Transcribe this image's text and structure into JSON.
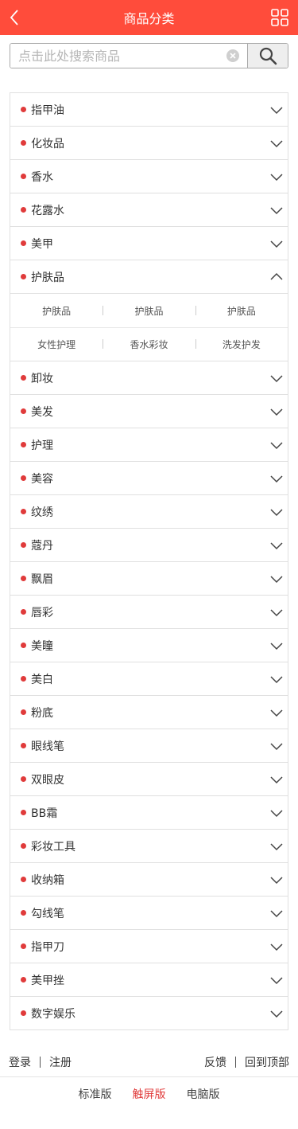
{
  "header": {
    "title": "商品分类",
    "back_icon": "chevron-left-icon",
    "menu_icon": "grid-icon",
    "accent": "#ff4c3b"
  },
  "search": {
    "placeholder": "点击此处搜索商品",
    "value": "",
    "clear_icon": "clear-icon",
    "button_icon": "search-icon"
  },
  "categories": [
    {
      "label": "指甲油",
      "expanded": false
    },
    {
      "label": "化妆品",
      "expanded": false
    },
    {
      "label": "香水",
      "expanded": false
    },
    {
      "label": "花露水",
      "expanded": false
    },
    {
      "label": "美甲",
      "expanded": false
    },
    {
      "label": "护肤品",
      "expanded": true,
      "subs": [
        "护肤品",
        "护肤品",
        "护肤品",
        "女性护理",
        "香水彩妆",
        "洗发护发"
      ]
    },
    {
      "label": "卸妆",
      "expanded": false
    },
    {
      "label": "美发",
      "expanded": false
    },
    {
      "label": "护理",
      "expanded": false
    },
    {
      "label": "美容",
      "expanded": false
    },
    {
      "label": "纹绣",
      "expanded": false
    },
    {
      "label": "蔻丹",
      "expanded": false
    },
    {
      "label": "飘眉",
      "expanded": false
    },
    {
      "label": "唇彩",
      "expanded": false
    },
    {
      "label": "美瞳",
      "expanded": false
    },
    {
      "label": "美白",
      "expanded": false
    },
    {
      "label": "粉底",
      "expanded": false
    },
    {
      "label": "眼线笔",
      "expanded": false
    },
    {
      "label": "双眼皮",
      "expanded": false
    },
    {
      "label": "BB霜",
      "expanded": false
    },
    {
      "label": "彩妆工具",
      "expanded": false
    },
    {
      "label": "收纳箱",
      "expanded": false
    },
    {
      "label": "勾线笔",
      "expanded": false
    },
    {
      "label": "指甲刀",
      "expanded": false
    },
    {
      "label": "美甲挫",
      "expanded": false
    },
    {
      "label": "数字娱乐",
      "expanded": false
    }
  ],
  "footer": {
    "login": "登录",
    "register": "注册",
    "feedback": "反馈",
    "back_to_top": "回到顶部",
    "versions": [
      {
        "label": "标准版",
        "active": false
      },
      {
        "label": "触屏版",
        "active": true
      },
      {
        "label": "电脑版",
        "active": false
      }
    ]
  },
  "colors": {
    "dot": "#e03b3b",
    "active_version": "#e03b3b"
  }
}
